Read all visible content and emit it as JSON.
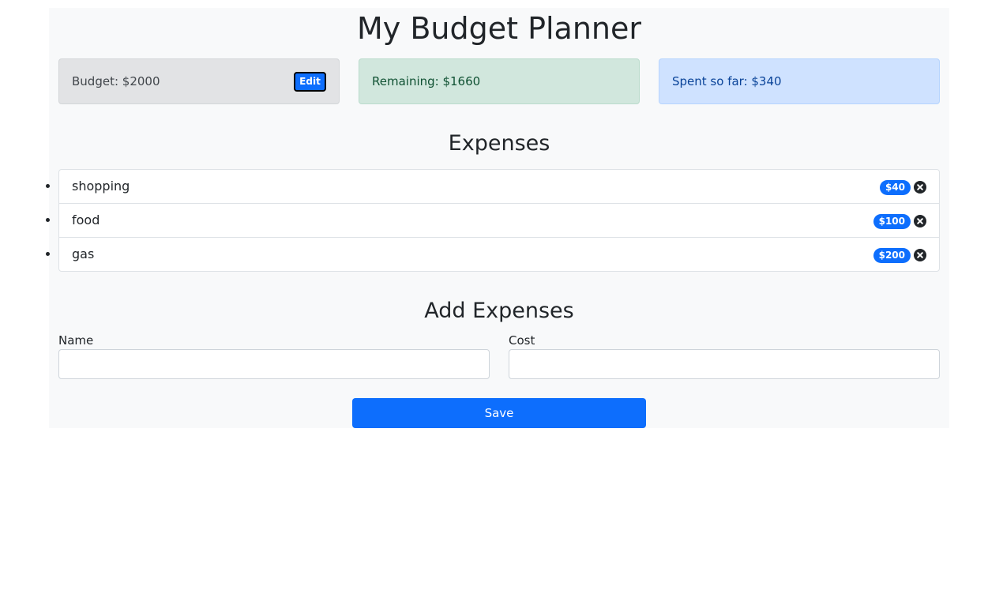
{
  "header": {
    "title": "My Budget Planner"
  },
  "summary": {
    "budget_label": "Budget: $2000",
    "edit_label": "Edit",
    "remaining_label": "Remaining: $1660",
    "spent_label": "Spent so far: $340"
  },
  "expenses": {
    "title": "Expenses",
    "items": [
      {
        "name": "shopping",
        "cost": "$40"
      },
      {
        "name": "food",
        "cost": "$100"
      },
      {
        "name": "gas",
        "cost": "$200"
      }
    ]
  },
  "add_form": {
    "title": "Add Expenses",
    "name_label": "Name",
    "name_value": "",
    "cost_label": "Cost",
    "cost_value": "",
    "save_label": "Save"
  },
  "icons": {
    "delete": "times-circle-icon"
  },
  "colors": {
    "primary": "#0d6efd",
    "budget_bg": "#e2e3e5",
    "remaining_bg": "#d1e7dd",
    "spent_bg": "#cfe2ff",
    "page_bg": "#f8f9fa"
  }
}
